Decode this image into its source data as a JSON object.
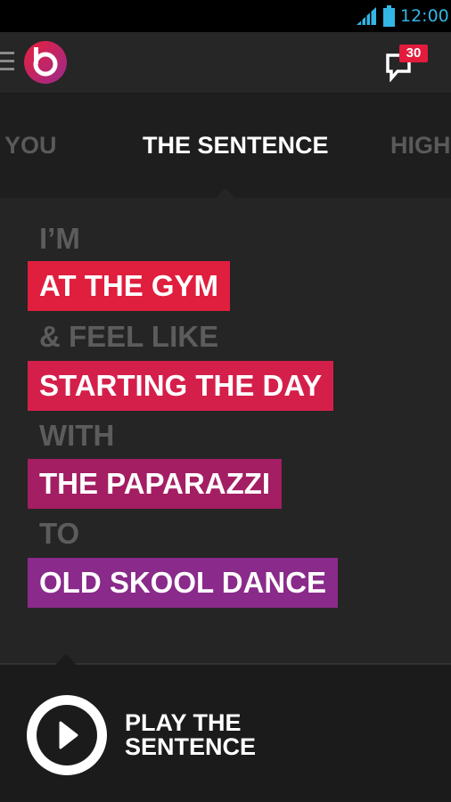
{
  "status_bar": {
    "time": "12:00",
    "signal_icon": "signal-icon",
    "battery_icon": "battery-icon",
    "accent_color": "#33b5e5"
  },
  "app_bar": {
    "menu_icon": "menu-icon",
    "logo_icon": "beats-logo-icon",
    "notifications": {
      "icon": "chat-bubble-icon",
      "count": "30"
    }
  },
  "tabs": [
    {
      "label": "YOU",
      "active": false
    },
    {
      "label": "THE SENTENCE",
      "active": true
    },
    {
      "label": "HIGH",
      "active": false
    }
  ],
  "sentence": {
    "connectors": [
      "I’M",
      "& FEEL LIKE",
      "WITH",
      "TO"
    ],
    "chips": [
      {
        "label": "AT THE GYM",
        "color": "#e01e3e"
      },
      {
        "label": "STARTING THE DAY",
        "color": "#d51f4b"
      },
      {
        "label": "THE PAPARAZZI",
        "color": "#a31e62"
      },
      {
        "label": "OLD SKOOL DANCE",
        "color": "#8a2a8a"
      }
    ]
  },
  "player": {
    "play_icon": "play-icon",
    "label_line1": "PLAY THE",
    "label_line2": "SENTENCE"
  }
}
